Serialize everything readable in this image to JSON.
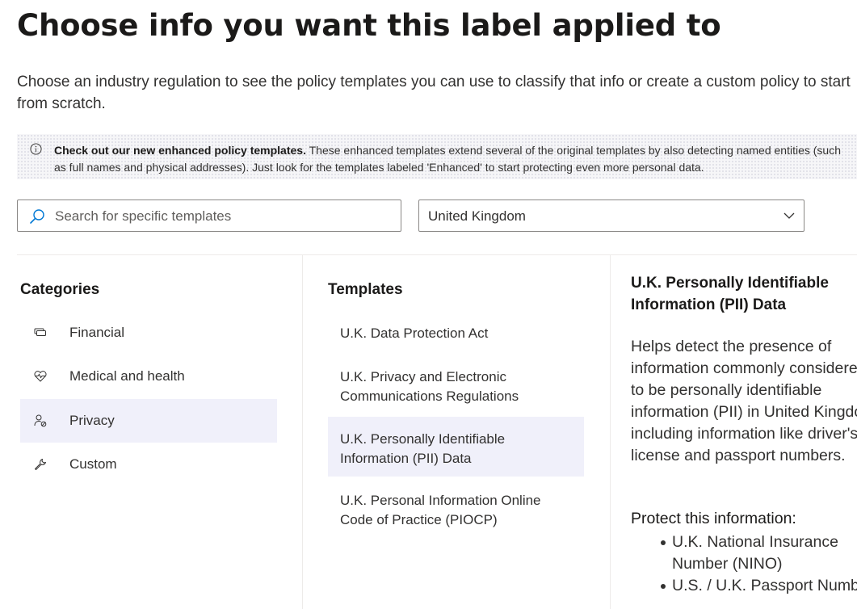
{
  "page": {
    "title": "Choose info you want this label applied to",
    "description": "Choose an industry regulation to see the policy templates you can use to classify that info or create a custom policy to start from scratch."
  },
  "banner": {
    "bold": "Check out our new enhanced policy templates.",
    "text": " These enhanced templates extend several of the original templates by also detecting named entities (such as full names and physical addresses). Just look for the templates labeled 'Enhanced' to start protecting even more personal data.",
    "icon": "info-icon"
  },
  "search": {
    "placeholder": "Search for specific templates",
    "value": "",
    "icon": "search-icon"
  },
  "region_dropdown": {
    "selected": "United Kingdom",
    "icon": "chevron-down-icon"
  },
  "categories": {
    "title": "Categories",
    "items": [
      {
        "label": "Financial",
        "icon": "financial-icon",
        "selected": false
      },
      {
        "label": "Medical and health",
        "icon": "heart-pulse-icon",
        "selected": false
      },
      {
        "label": "Privacy",
        "icon": "person-privacy-icon",
        "selected": true
      },
      {
        "label": "Custom",
        "icon": "wrench-icon",
        "selected": false
      }
    ]
  },
  "templates": {
    "title": "Templates",
    "items": [
      {
        "line1": "U.K. Data Protection Act",
        "line2": "",
        "selected": false
      },
      {
        "line1": "U.K. Privacy and Electronic",
        "line2": "Communications Regulations",
        "selected": false
      },
      {
        "line1": "U.K. Personally Identifiable",
        "line2": "Information (PII) Data",
        "selected": true
      },
      {
        "line1": "U.K. Personal Information Online",
        "line2": "Code of Practice (PIOCP)",
        "selected": false
      }
    ]
  },
  "details": {
    "title_line1": "U.K. Personally Identifiable",
    "title_line2": "Information (PII) Data",
    "description_lines": [
      "Helps detect the presence of",
      "information commonly considered",
      "to be personally identifiable",
      "information (PII) in United Kingdom",
      "including information like driver's",
      "license and passport numbers."
    ],
    "protect_title": "Protect this information:",
    "protect_items": [
      {
        "line1": "U.K. National Insurance",
        "line2": "Number (NINO)"
      },
      {
        "line1": "U.S. / U.K. Passport Number",
        "line2": ""
      }
    ]
  }
}
